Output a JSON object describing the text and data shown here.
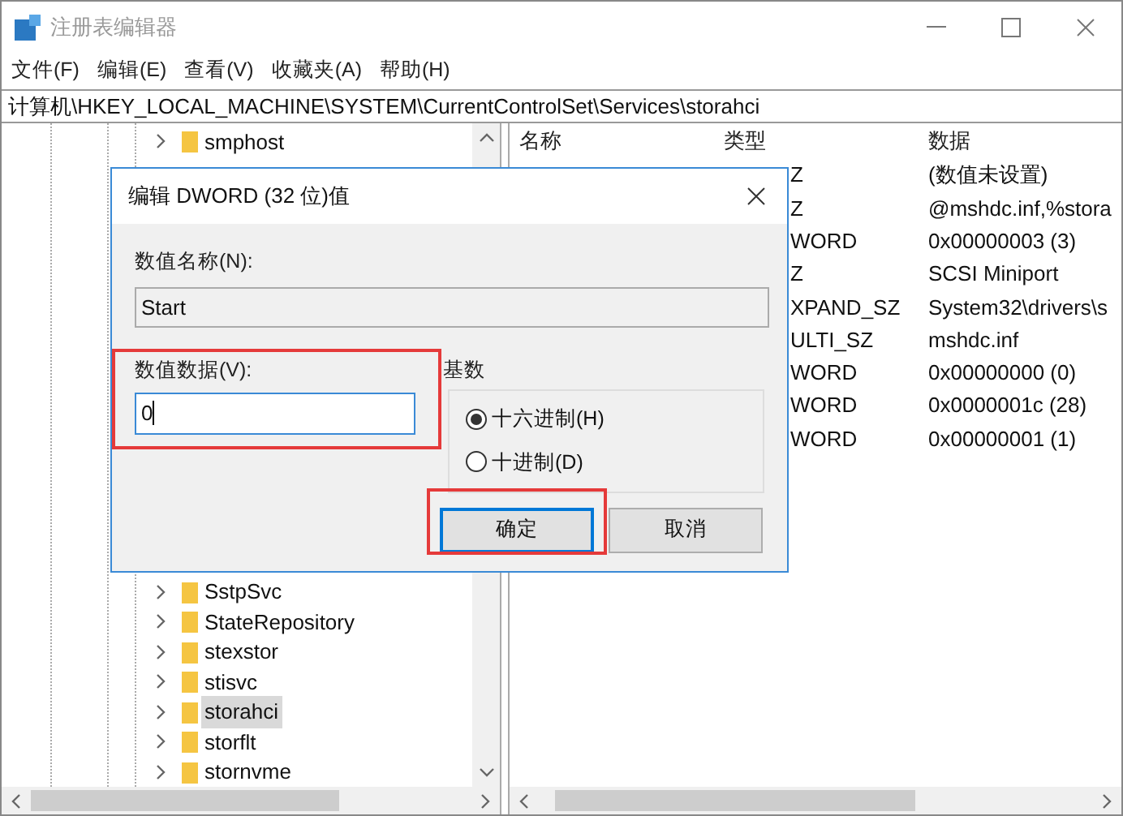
{
  "window": {
    "title": "注册表编辑器"
  },
  "menu": [
    "文件(F)",
    "编辑(E)",
    "查看(V)",
    "收藏夹(A)",
    "帮助(H)"
  ],
  "address": "计算机\\HKEY_LOCAL_MACHINE\\SYSTEM\\CurrentControlSet\\Services\\storahci",
  "tree": {
    "top_items": [
      {
        "label": "smphost",
        "selected": false
      }
    ],
    "bottom_items": [
      {
        "label": "SstpSvc",
        "selected": false
      },
      {
        "label": "StateRepository",
        "selected": false
      },
      {
        "label": "stexstor",
        "selected": false
      },
      {
        "label": "stisvc",
        "selected": false
      },
      {
        "label": "storahci",
        "selected": true
      },
      {
        "label": "storflt",
        "selected": false
      },
      {
        "label": "stornvme",
        "selected": false
      }
    ]
  },
  "values": {
    "columns": [
      "名称",
      "类型",
      "数据"
    ],
    "rows": [
      {
        "type": "Z",
        "data": "(数值未设置)"
      },
      {
        "type": "Z",
        "data": "@mshdc.inf,%stora"
      },
      {
        "type": "WORD",
        "data": "0x00000003 (3)"
      },
      {
        "type": "Z",
        "data": "SCSI Miniport"
      },
      {
        "type": "XPAND_SZ",
        "data": "System32\\drivers\\s"
      },
      {
        "type": "ULTI_SZ",
        "data": "mshdc.inf"
      },
      {
        "type": "WORD",
        "data": "0x00000000 (0)"
      },
      {
        "type": "WORD",
        "data": "0x0000001c (28)"
      },
      {
        "type": "WORD",
        "data": "0x00000001 (1)"
      }
    ]
  },
  "dialog": {
    "title": "编辑 DWORD (32 位)值",
    "name_label": "数值名称(N):",
    "name_value": "Start",
    "data_label": "数值数据(V):",
    "data_value": "0",
    "base_label": "基数",
    "radios": [
      {
        "label": "十六进制(H)",
        "selected": true
      },
      {
        "label": "十进制(D)",
        "selected": false
      }
    ],
    "buttons": [
      {
        "label": "确定",
        "default": true
      },
      {
        "label": "取消",
        "default": false
      }
    ]
  }
}
